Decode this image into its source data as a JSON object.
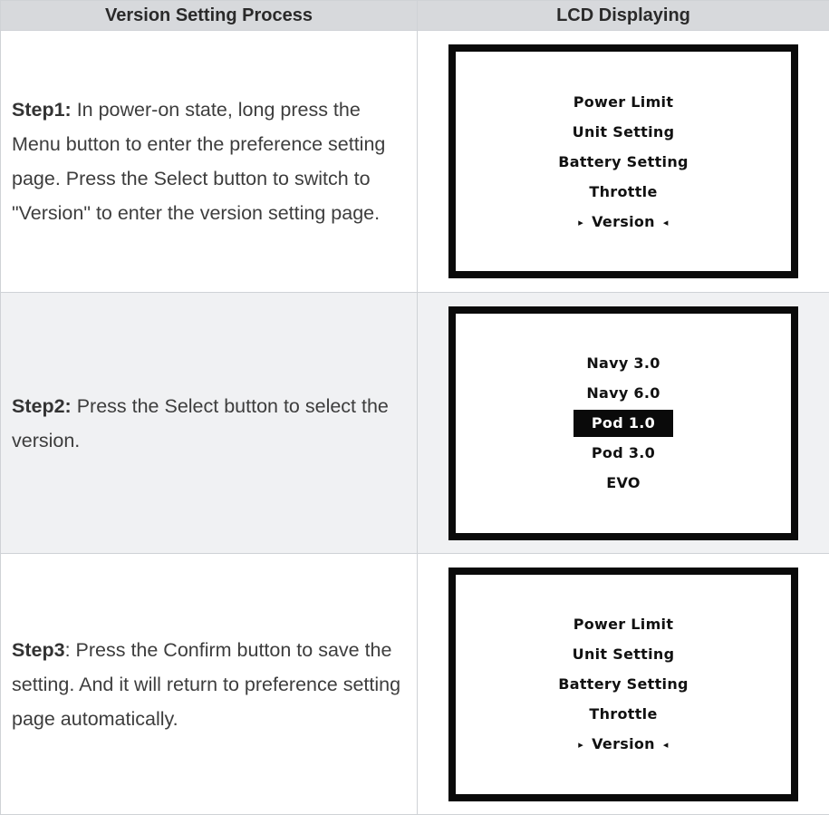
{
  "table": {
    "headers": [
      "Version Setting Process",
      "LCD Displaying"
    ]
  },
  "steps": [
    {
      "label": "Step1:",
      "text": " In power-on state, long press the Menu button to enter the preference setting page. Press the Select button to switch to \"Version\" to enter the version setting page.",
      "lcd": {
        "lines": [
          "Power Limit",
          "Unit Setting",
          "Battery Setting",
          "Throttle"
        ],
        "selected_line": "Version",
        "selection_style": "arrows"
      }
    },
    {
      "label": "Step2:",
      "text": " Press the Select button to select the version.",
      "lcd": {
        "lines_before": [
          "Navy 3.0",
          "Navy 6.0"
        ],
        "selected_line": "Pod 1.0",
        "lines_after": [
          "Pod 3.0",
          "EVO"
        ],
        "selection_style": "highlight"
      }
    },
    {
      "label": "Step3",
      "text": ": Press the Confirm button to save the setting. And it will return to preference setting page automatically.",
      "lcd": {
        "lines": [
          "Power Limit",
          "Unit Setting",
          "Battery Setting",
          "Throttle"
        ],
        "selected_line": "Version",
        "selection_style": "arrows"
      }
    }
  ],
  "icons": {
    "left_arrow": "▸",
    "right_arrow": "◂"
  },
  "colors": {
    "header_bg": "#d7d9dc",
    "alt_row_bg": "#f0f1f3",
    "lcd_border": "#0a0a0a",
    "lcd_highlight": "#0a0a0a"
  }
}
